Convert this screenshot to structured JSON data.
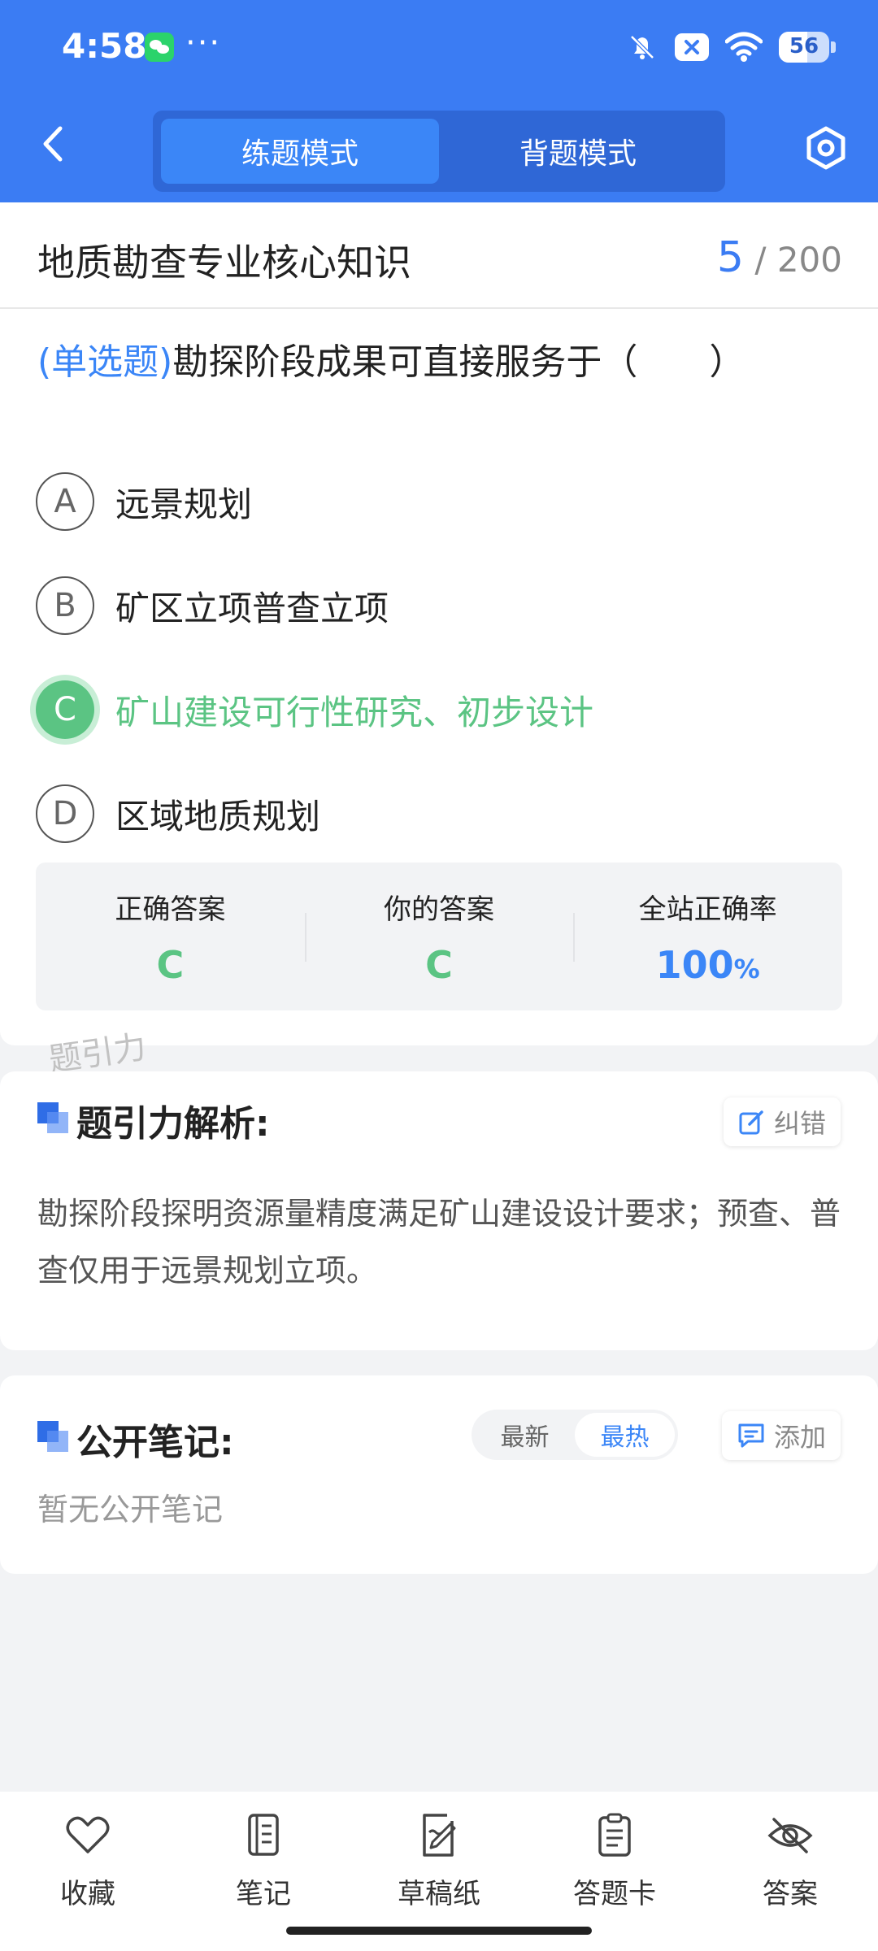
{
  "status_bar": {
    "time": "4:58",
    "more": "···",
    "battery": "56",
    "battery_level": 0.56
  },
  "header": {
    "back_icon": "chevron-left-icon",
    "tabs": [
      {
        "label": "练题模式",
        "active": true
      },
      {
        "label": "背题模式",
        "active": false
      }
    ],
    "settings_icon": "hexagon-settings-icon"
  },
  "subject": {
    "title": "地质勘查专业核心知识",
    "current": "5",
    "total": "/ 200"
  },
  "question": {
    "type": "(单选题)",
    "text": "勘探阶段成果可直接服务于（　　）",
    "options": [
      {
        "letter": "A",
        "text": "远景规划",
        "correct": false
      },
      {
        "letter": "B",
        "text": "矿区立项普查立项",
        "correct": false
      },
      {
        "letter": "C",
        "text": "矿山建设可行性研究、初步设计",
        "correct": true
      },
      {
        "letter": "D",
        "text": "区域地质规划",
        "correct": false
      }
    ]
  },
  "stats": {
    "correct_label": "正确答案",
    "correct_value": "C",
    "yours_label": "你的答案",
    "yours_value": "C",
    "rate_label": "全站正确率",
    "rate_value": "100",
    "rate_unit": "%"
  },
  "watermark": "题引力",
  "explanation": {
    "title": "题引力解析:",
    "report_label": "纠错",
    "text": "勘探阶段探明资源量精度满足矿山建设设计要求；预查、普查仅用于远景规划立项。"
  },
  "notes": {
    "title": "公开笔记:",
    "sort": [
      {
        "label": "最新",
        "active": false
      },
      {
        "label": "最热",
        "active": true
      }
    ],
    "add_label": "添加",
    "empty": "暂无公开笔记"
  },
  "bottom_nav": [
    {
      "label": "收藏",
      "icon": "heart-icon"
    },
    {
      "label": "笔记",
      "icon": "notebook-icon"
    },
    {
      "label": "草稿纸",
      "icon": "draft-paper-icon"
    },
    {
      "label": "答题卡",
      "icon": "answer-card-icon"
    },
    {
      "label": "答案",
      "icon": "eye-off-icon"
    }
  ],
  "colors": {
    "primary": "#3b7cf3",
    "correct": "#5bc483",
    "muted": "#999999"
  }
}
